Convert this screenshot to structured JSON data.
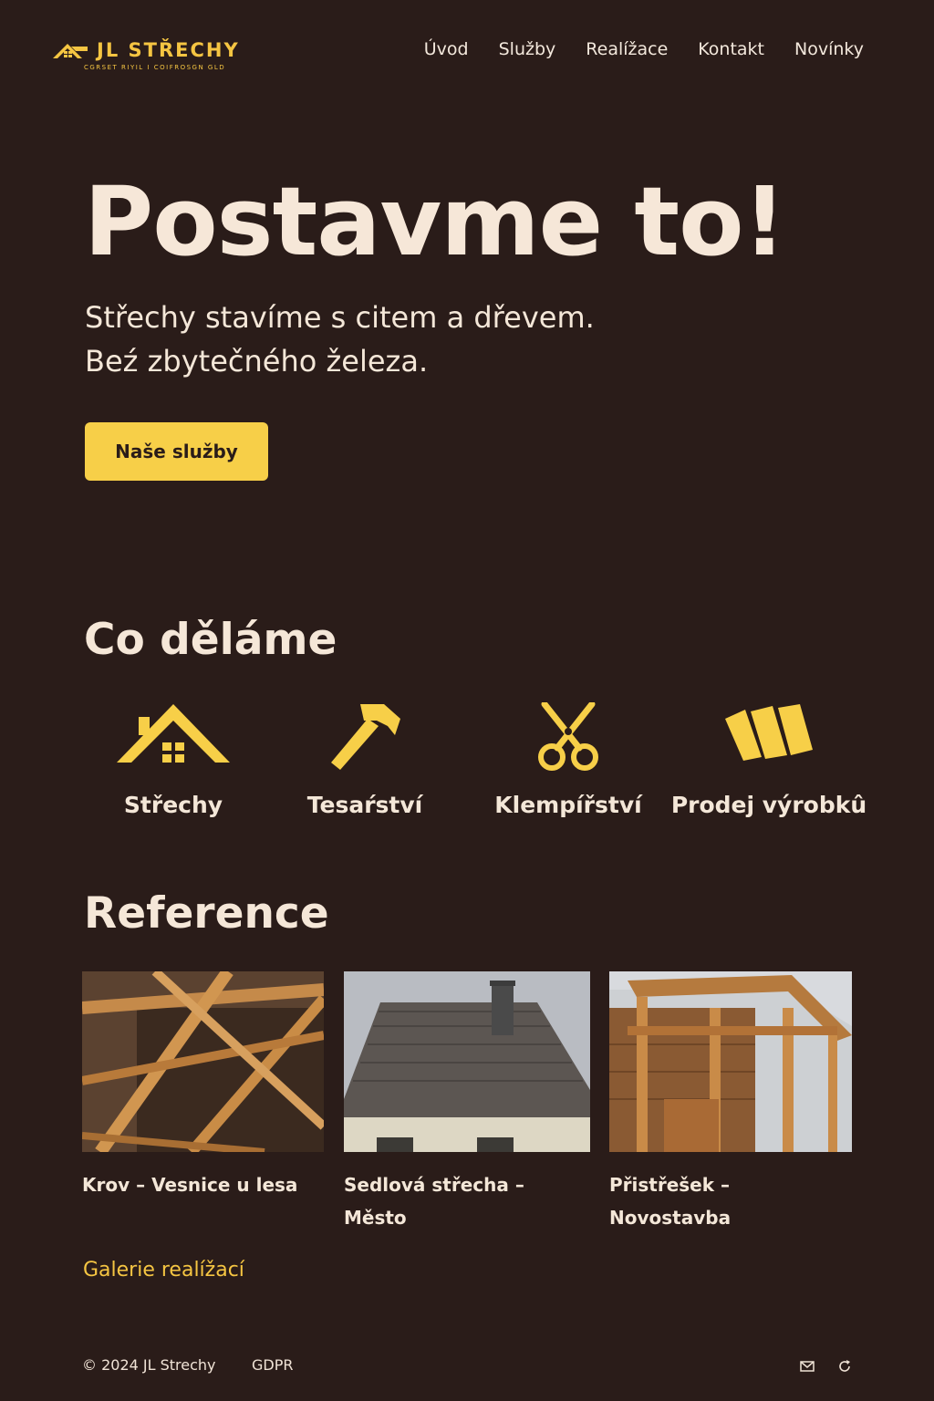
{
  "brand": {
    "name": "JL STŘECHY",
    "tagline": "CGRSET RIYIL I COIFROSGN GLD"
  },
  "nav": {
    "items": [
      {
        "label": "Úvod"
      },
      {
        "label": "Služby"
      },
      {
        "label": "Realížace"
      },
      {
        "label": "Kontakt"
      },
      {
        "label": "Novínky"
      }
    ]
  },
  "hero": {
    "title": "Postavme to!",
    "subtitle_line1": "Střechy stavíme s citem a dřevem.",
    "subtitle_line2": "Beź zbytečného železa.",
    "cta_label": "Naše služby"
  },
  "services": {
    "title": "Co děláme",
    "items": [
      {
        "label": "Střechy",
        "icon": "house-roof-icon"
      },
      {
        "label": "Tesaŕství",
        "icon": "hammer-icon"
      },
      {
        "label": "Klempířství",
        "icon": "scissors-icon"
      },
      {
        "label": "Prodej výrobkû",
        "icon": "panels-icon"
      }
    ]
  },
  "references": {
    "title": "Reference",
    "items": [
      {
        "title": "Krov – Vesnice u lesa"
      },
      {
        "title": "Sedlová střecha – Město"
      },
      {
        "title": "Přistřešek – Novostavba"
      }
    ],
    "gallery_link": "Galerie realížací"
  },
  "footer": {
    "copyright": "© 2024 JL Strechy",
    "gdpr": "GDPR",
    "icons": [
      "mail-icon",
      "refresh-icon"
    ]
  },
  "colors": {
    "background": "#2a1c19",
    "accent": "#f7cf48",
    "text": "#f4e7d8"
  }
}
